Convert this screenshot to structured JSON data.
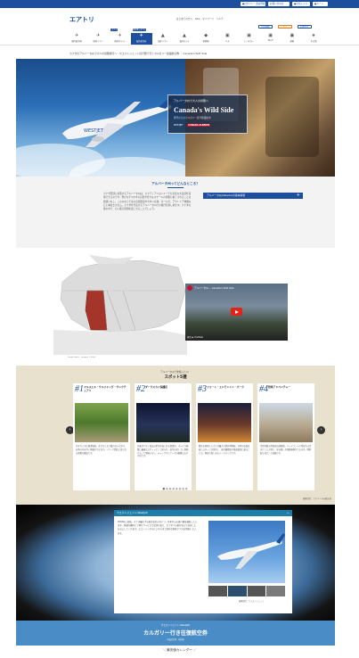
{
  "topbar": {
    "items": [
      "●ログイン・会員登録",
      "お問い合わせ",
      "●お気に入り",
      "●カート"
    ]
  },
  "header": {
    "logo": "エアトリ",
    "subnav": "はじめての方へ　Q&A　マイページ　ヘルプ",
    "buttons": [
      "会員登録",
      "ログイン",
      "お問合せ"
    ],
    "nav": [
      {
        "label": "国内航空券",
        "icon": "✈",
        "badge": ""
      },
      {
        "label": "国内ツアー",
        "icon": "✈",
        "badge": ""
      },
      {
        "label": "国内ホテル",
        "icon": "✈",
        "badge": "ホテル"
      },
      {
        "label": "海外航空券",
        "icon": "✈",
        "badge": "航空券+ホテル"
      },
      {
        "label": "海外ツアー",
        "icon": "▲",
        "badge": ""
      },
      {
        "label": "海外ホテル",
        "icon": "▲",
        "badge": ""
      },
      {
        "label": "新幹線",
        "icon": "◆",
        "badge": ""
      },
      {
        "label": "バス",
        "icon": "▣",
        "badge": ""
      },
      {
        "label": "レンタカー",
        "icon": "▣",
        "badge": ""
      },
      {
        "label": "Wi-Fi",
        "icon": "▣",
        "badge": ""
      },
      {
        "label": "保険",
        "icon": "▣",
        "badge": ""
      },
      {
        "label": "その他",
        "icon": "★",
        "badge": ""
      }
    ]
  },
  "breadcrumb": "カナダのアルバータ州で大人の冒険旅行へ　ウエストジェット直行便で行くカルガリー往復航空券 ｜ Canada's Wild Side",
  "hero": {
    "overlay_sub": "アルバータ州で大人の冒険へ",
    "overlay_title": "Canada's Wild Side",
    "overlay_line": "現代からのカルガリー直行便運航中",
    "overlay_logo1": "WESTJET",
    "overlay_logo2": "CANADA ALBERTA",
    "plane_livery": "WESTJET"
  },
  "intro": {
    "title": "アルバータ州ってどんなところ？",
    "paragraph": "カナダ西部に位置するアルバータ州は、カナディアンロッキーでも有名な大自然を満喫できる州です。豊かな手つかずの自然や壮大なスケールの景観に魅了されることは間違いなし。この州ならではの自然環境やきれいな湖、オーロラ、アウトドア体験などに事欠きません。カナダを代表するアルバータ州での旅行を楽しめます。カナダの旅の中で、心に残る時間を過ごせることでしょう。",
    "cta": "アルバータ州(Alberta)の基本情報"
  },
  "map": {
    "credit": "Google Earth · Imagery ©2024"
  },
  "video": {
    "title": "アルバータ州 — Canada's Wild Side",
    "bar": "再生 ▶ YouTube"
  },
  "spots": {
    "sub": "アルバータ州で体験したい！",
    "title": "スポット5選",
    "cards": [
      {
        "num": "#1",
        "title": "マルスエル・ウルフドッグ・サンクチュアリ",
        "text": "オオカミ犬の保護施設。オオカミ犬と触れ合いながら、自然の中を歩く体験ができます。ツアーで間近に見られる貴重な機会です。"
      },
      {
        "num": "#2",
        "title": "ダークスカイ保護区",
        "text": "光害が少なく満天の星空を楽しめる保護区。オーロラ観賞に最適なスポットとして知られ、夜空の美しさに感動すること間違いなし。キャンプやツアーでの観賞もおすすめです。"
      },
      {
        "num": "#3",
        "title": "フォート・エドモントン・パーク",
        "text": "歴史を再現したカナダ最大の野外博物館。当時の衣装を着たスタッフが案内し、蒸気機関車や路面電車に乗ることも。家族で楽しめるテーマパークです。"
      },
      {
        "num": "#4",
        "title": "恐竜アドベンチャー",
        "text": "世界有数の恐竜化石発掘地。バッドランドと呼ばれる荒涼とした大地で、化石探しや発掘体験ができます。博物館も見どころ満載です。"
      }
    ],
    "credit": "画像提供：アルバータ州観光局"
  },
  "westjet": {
    "header": "ウエストジェット(WestJet)",
    "text": "2002年に就航。カナダ最大手の航空会社のひとつ。日本からの直行便を運航しています。快適な機内と丁寧なサービスで定評があり、カナダへの旅行をより充実したものにしてくれます。エコノミーからビジネスまで多彩な座席クラスを用意しています。",
    "caption": "画像提供：ウエストジェット"
  },
  "fare": {
    "sub": "ウエストジェット(WestJet)",
    "title": "カルガリー行き往復航空券",
    "note": "※成田空港・羽田発"
  },
  "calendar": "＼ 最安値カレンダー ／"
}
